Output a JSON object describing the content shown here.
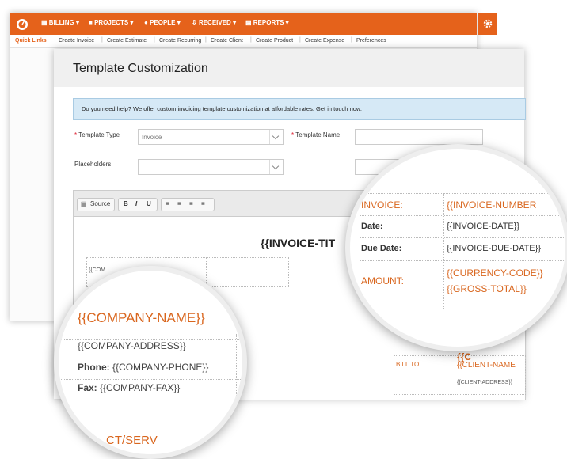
{
  "navbar": {
    "items": [
      "BILLING",
      "PROJECTS",
      "PEOPLE",
      "RECEIVED",
      "REPORTS"
    ],
    "accent": "#e5621b"
  },
  "quick_links": {
    "label": "Quick Links",
    "items": [
      "Create Invoice",
      "Create Estimate",
      "Create Recurring",
      "Create Client",
      "Create Product",
      "Create Expense",
      "Preferences"
    ]
  },
  "page": {
    "title": "Template Customization",
    "help_text": "Do you need help? We offer custom invoicing template customization at affordable rates.",
    "help_link": "Get in touch",
    "help_tail": "now.",
    "template_type_label": "Template Type",
    "template_type_value": "Invoice",
    "template_name_label": "Template Name",
    "placeholders_label": "Placeholders"
  },
  "editor": {
    "source_label": "Source",
    "bold": "B",
    "italic": "I",
    "underline": "U",
    "doc_title": "{{INVOICE-TIT",
    "company_cell": "{{COM",
    "bill_to_label": "BILL TO:",
    "client_name": "{{CLIENT-NAME",
    "client_address": "{{CLIENT-ADDRESS}}",
    "client_top": "{{C"
  },
  "magnifier_left": {
    "company_name": "{{COMPANY-NAME}}",
    "company_address": "{{COMPANY-ADDRESS}}",
    "phone_label": "Phone:",
    "phone_value": "{{COMPANY-PHONE}}",
    "fax_label": "Fax:",
    "fax_value": "{{COMPANY-FAX}}",
    "bottom_partial": "CT/SERV"
  },
  "magnifier_right": {
    "invoice_label": "INVOICE:",
    "invoice_value": "{{INVOICE-NUMBER",
    "date_label": "Date:",
    "date_value": "{{INVOICE-DATE}}",
    "due_label": "Due Date:",
    "due_value": "{{INVOICE-DUE-DATE}}",
    "amount_label": "AMOUNT:",
    "currency_value": "{{CURRENCY-CODE}}",
    "gross_value": "{{GROSS-TOTAL}}"
  }
}
